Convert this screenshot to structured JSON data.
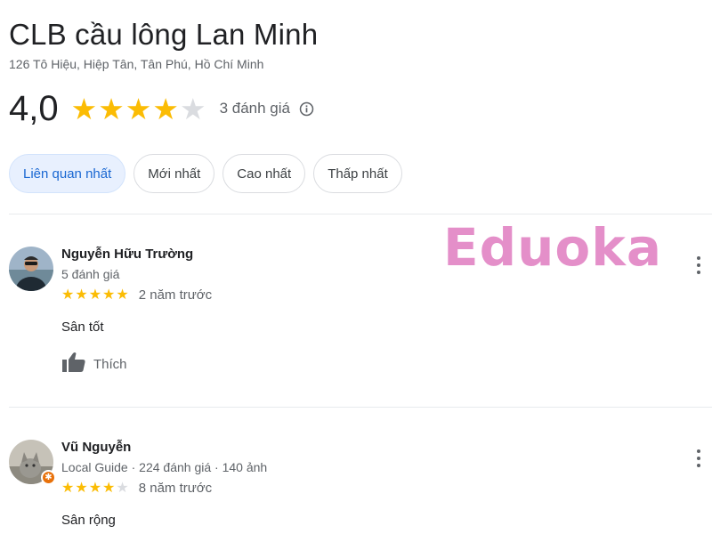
{
  "place": {
    "name": "CLB cầu lông Lan Minh",
    "address": "126 Tô Hiệu, Hiệp Tân, Tân Phú, Hồ Chí Minh",
    "rating": "4,0",
    "stars_filled": 4,
    "stars_total": 5,
    "review_count": "3 đánh giá"
  },
  "sort_chips": [
    {
      "label": "Liên quan nhất",
      "selected": true
    },
    {
      "label": "Mới nhất",
      "selected": false
    },
    {
      "label": "Cao nhất",
      "selected": false
    },
    {
      "label": "Thấp nhất",
      "selected": false
    }
  ],
  "watermark": "Eduoka",
  "reviews": [
    {
      "author": "Nguyễn Hữu Trường",
      "meta": "5 đánh giá",
      "stars_filled": 5,
      "time": "2 năm trước",
      "text": "Sân tốt",
      "like_label": "Thích"
    },
    {
      "author": "Vũ Nguyễn",
      "meta": "Local Guide · 224 đánh giá · 140 ảnh",
      "stars_filled": 4,
      "time": "8 năm trước",
      "text": "Sân rộng"
    }
  ],
  "colors": {
    "star_on": "#fbbc04",
    "star_off": "#dadce0",
    "chip_selected_bg": "#e8f0fe",
    "chip_selected_text": "#1967d2",
    "watermark": "#e07cc0",
    "local_guide_badge": "#e8710a"
  },
  "icons": [
    "star-icon",
    "info-icon",
    "thumbs-up-icon",
    "more-vert-icon",
    "local-guide-badge-icon"
  ]
}
